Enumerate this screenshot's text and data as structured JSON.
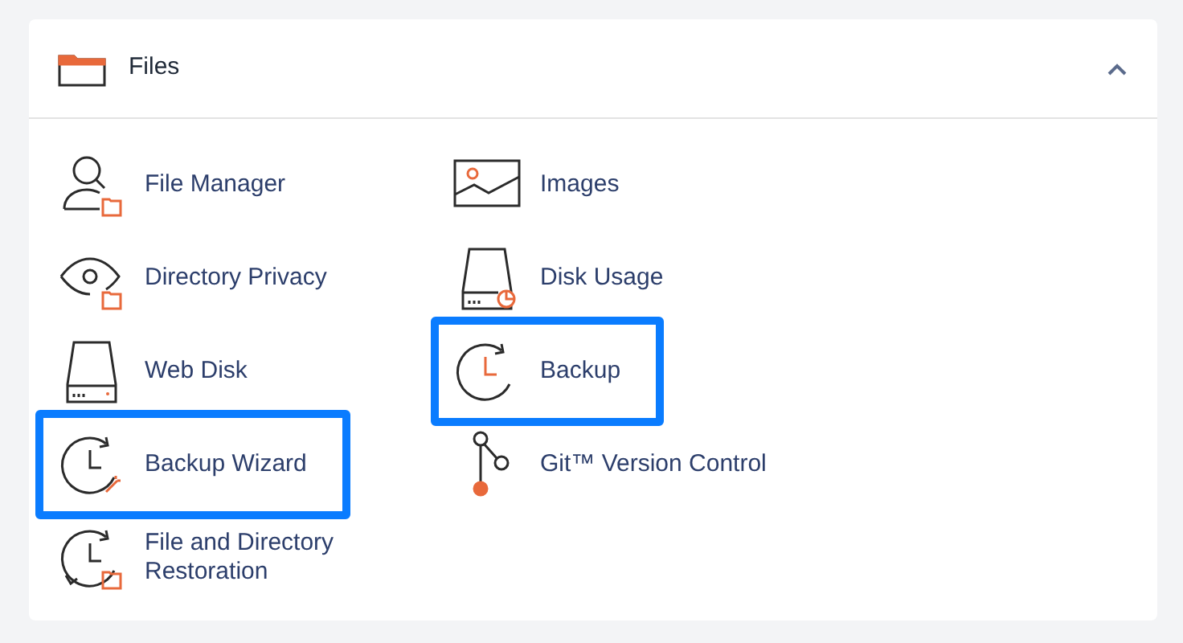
{
  "panel": {
    "title": "Files",
    "expanded": true
  },
  "columns": [
    {
      "items": [
        {
          "label": "File Manager",
          "kind": "file-manager",
          "highlighted": false
        },
        {
          "label": "Directory Privacy",
          "kind": "privacy",
          "highlighted": false
        },
        {
          "label": "Web Disk",
          "kind": "disk",
          "highlighted": false
        },
        {
          "label": "Backup Wizard",
          "kind": "wizard",
          "highlighted": true
        },
        {
          "label": "File and Directory Restoration",
          "kind": "restore",
          "highlighted": false
        }
      ]
    },
    {
      "items": [
        {
          "label": "Images",
          "kind": "images",
          "highlighted": false
        },
        {
          "label": "Disk Usage",
          "kind": "disk-usage",
          "highlighted": false
        },
        {
          "label": "Backup",
          "kind": "backup",
          "highlighted": true
        },
        {
          "label": "Git™ Version Control",
          "kind": "git",
          "highlighted": false
        }
      ]
    }
  ]
}
